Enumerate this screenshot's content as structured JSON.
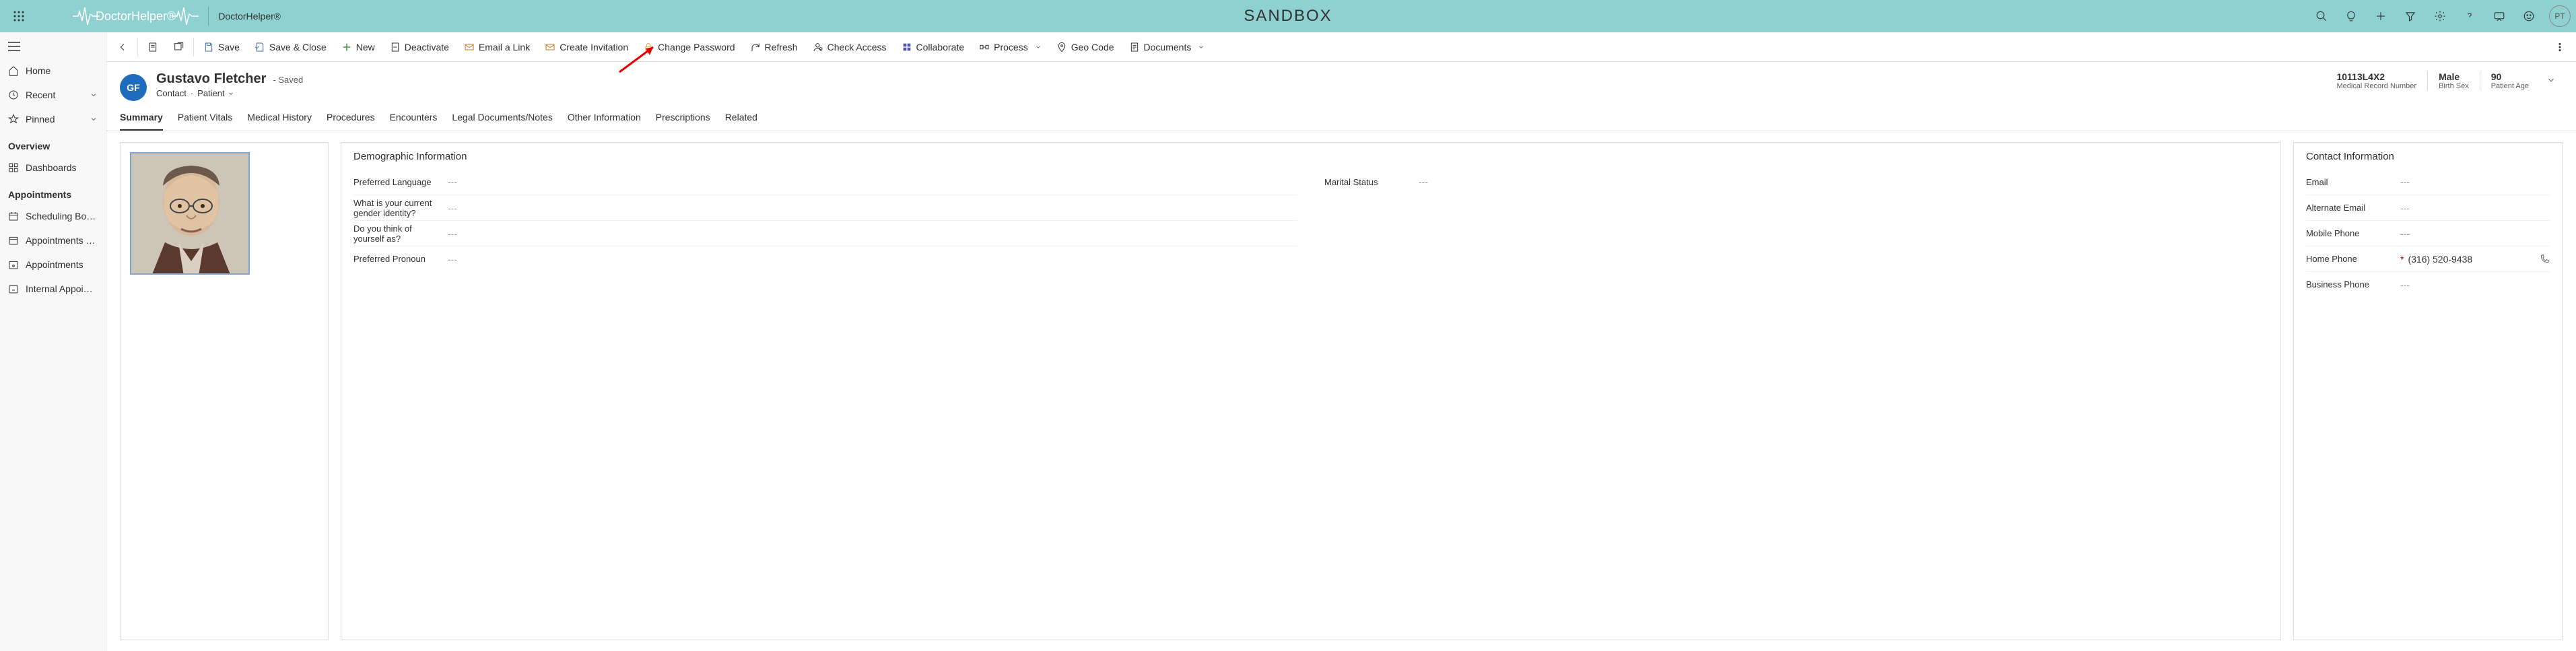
{
  "topbar": {
    "logo_text": "DoctorHelper®",
    "app_name": "DoctorHelper®",
    "center_title": "SANDBOX",
    "user_initials": "PT"
  },
  "leftnav": {
    "home": "Home",
    "recent": "Recent",
    "pinned": "Pinned",
    "section_overview": "Overview",
    "dashboards": "Dashboards",
    "section_appointments": "Appointments",
    "scheduling_board": "Scheduling Board",
    "appointments_bo": "Appointments Bo...",
    "appointments": "Appointments",
    "internal_appoint": "Internal Appoint..."
  },
  "cmdbar": {
    "save": "Save",
    "save_close": "Save & Close",
    "new": "New",
    "deactivate": "Deactivate",
    "email_link": "Email a Link",
    "create_invitation": "Create Invitation",
    "change_password": "Change Password",
    "refresh": "Refresh",
    "check_access": "Check Access",
    "collaborate": "Collaborate",
    "process": "Process",
    "geo_code": "Geo Code",
    "documents": "Documents"
  },
  "record": {
    "initials": "GF",
    "name": "Gustavo Fletcher",
    "saved_suffix": "- Saved",
    "entity": "Contact",
    "form": "Patient",
    "mrn_value": "10113L4X2",
    "mrn_label": "Medical Record Number",
    "sex_value": "Male",
    "sex_label": "Birth Sex",
    "age_value": "90",
    "age_label": "Patient Age"
  },
  "tabs": {
    "summary": "Summary",
    "vitals": "Patient Vitals",
    "history": "Medical History",
    "procedures": "Procedures",
    "encounters": "Encounters",
    "legal": "Legal Documents/Notes",
    "other": "Other Information",
    "prescriptions": "Prescriptions",
    "related": "Related"
  },
  "demo": {
    "title": "Demographic Information",
    "preferred_language_lbl": "Preferred Language",
    "preferred_language_val": "---",
    "gender_identity_lbl": "What is your current gender identity?",
    "gender_identity_val": "---",
    "think_of_lbl": "Do you think of yourself as?",
    "think_of_val": "---",
    "pronoun_lbl": "Preferred Pronoun",
    "pronoun_val": "---",
    "marital_lbl": "Marital Status",
    "marital_val": "---"
  },
  "contact": {
    "title": "Contact Information",
    "email_lbl": "Email",
    "email_val": "---",
    "alt_email_lbl": "Alternate Email",
    "alt_email_val": "---",
    "mobile_lbl": "Mobile Phone",
    "mobile_val": "---",
    "home_lbl": "Home Phone",
    "home_val": "(316) 520-9438",
    "business_lbl": "Business Phone",
    "business_val": "---"
  }
}
